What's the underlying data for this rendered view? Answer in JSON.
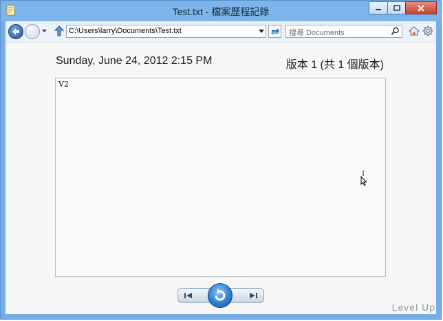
{
  "window": {
    "title": "Test.txt - 檔案歷程記錄",
    "controls": [
      "minimize",
      "maximize",
      "close"
    ]
  },
  "toolbar": {
    "address_value": "C:\\Users\\larry\\Documents\\Test.txt",
    "search_placeholder": "搜尋 Documents"
  },
  "main": {
    "date": "Sunday, June 24, 2012 2:15 PM",
    "version": "版本 1 (共 1 個版本)",
    "preview_text": "V2"
  },
  "watermark": "Level Up",
  "icons": {
    "back": "back-arrow-icon",
    "forward": "forward-arrow-icon",
    "up": "up-arrow-icon",
    "refresh": "refresh-icon",
    "search": "search-icon",
    "home": "home-icon",
    "settings": "gear-icon",
    "previous": "previous-version-icon",
    "next": "next-version-icon",
    "restore": "restore-icon"
  },
  "colors": {
    "titlebar": "#7bb5ea",
    "content_bg": "#f7f7f7",
    "accent": "#2f7fd0"
  }
}
